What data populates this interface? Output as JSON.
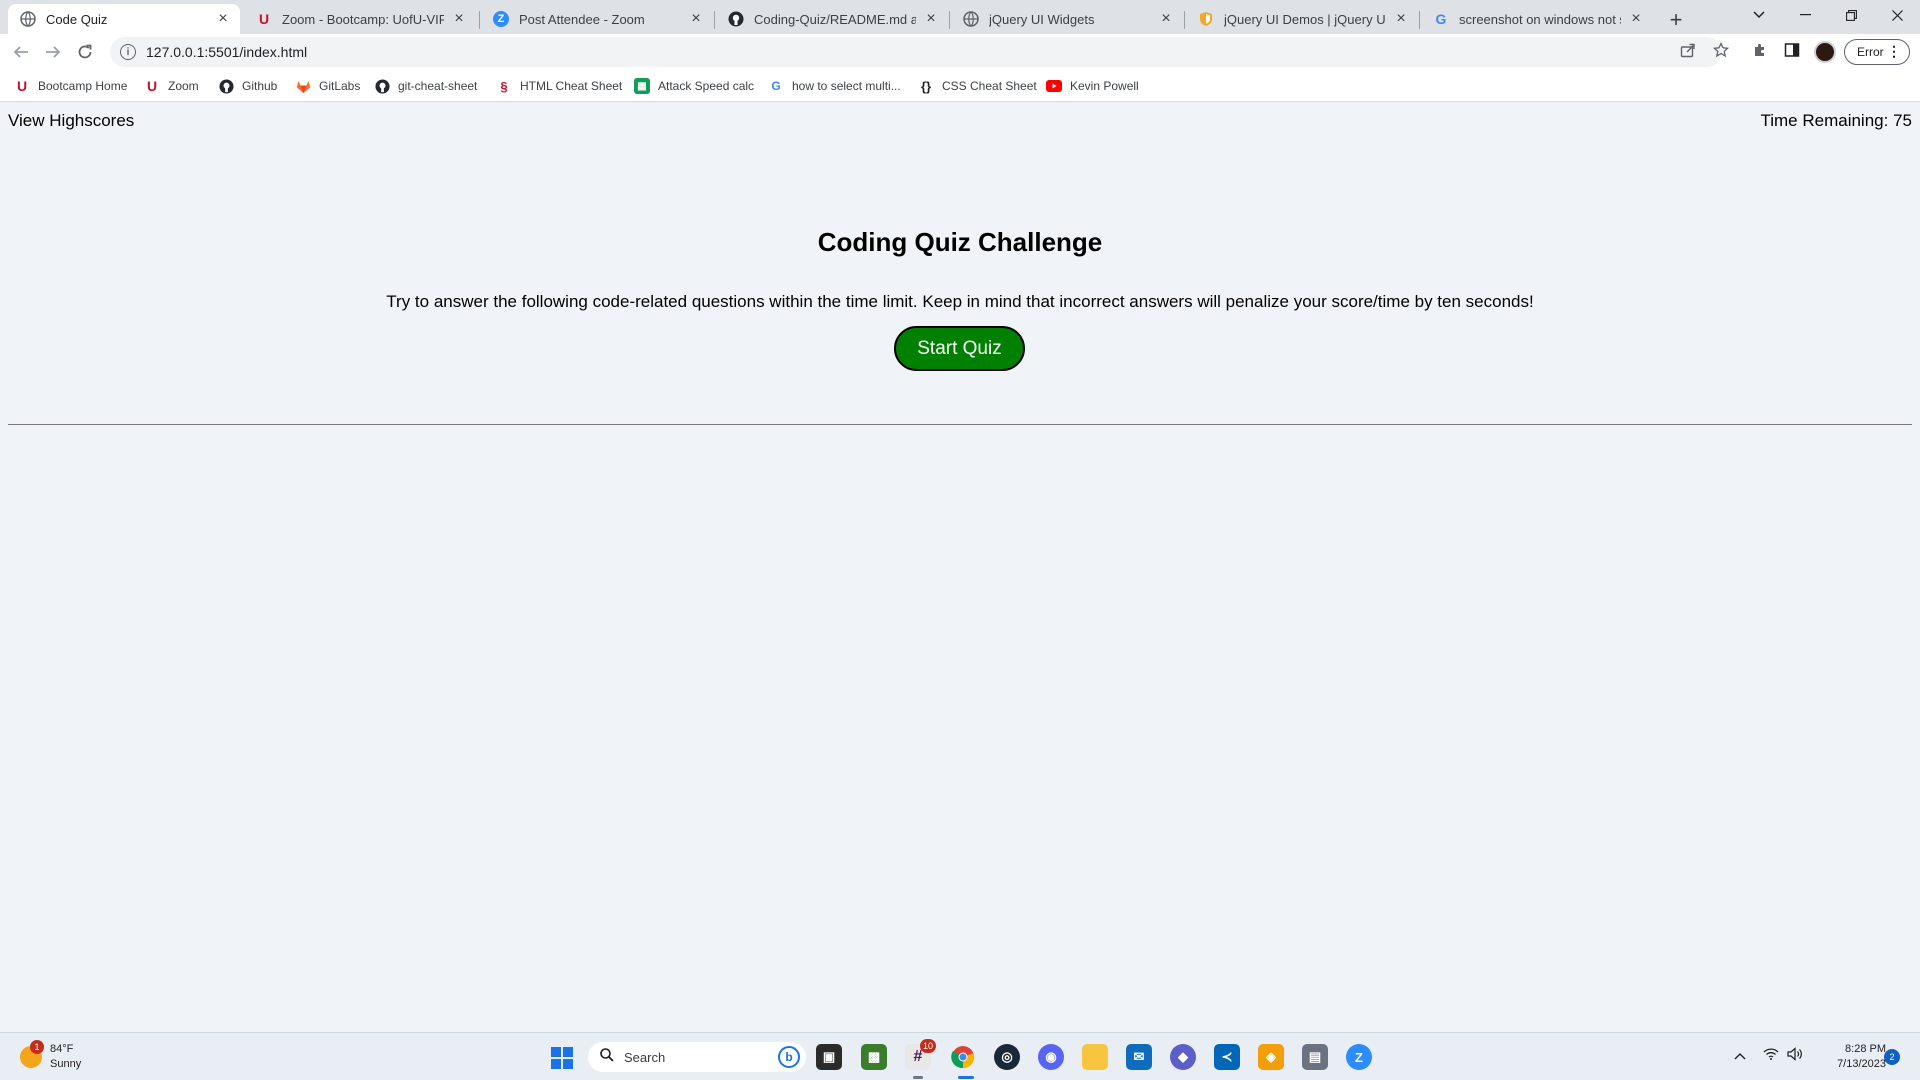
{
  "browser": {
    "tabs": [
      {
        "title": "Code Quiz",
        "active": true,
        "icon": "globe-icon"
      },
      {
        "title": "Zoom - Bootcamp: UofU-VIRT-F",
        "active": false,
        "icon": "utah-u-icon"
      },
      {
        "title": "Post Attendee - Zoom",
        "active": false,
        "icon": "zoom-icon"
      },
      {
        "title": "Coding-Quiz/README.md at ma",
        "active": false,
        "icon": "github-icon"
      },
      {
        "title": "jQuery UI Widgets",
        "active": false,
        "icon": "globe-icon"
      },
      {
        "title": "jQuery UI Demos | jQuery UI",
        "active": false,
        "icon": "jquery-shield-icon"
      },
      {
        "title": "screenshot on windows not savi",
        "active": false,
        "icon": "google-icon"
      }
    ],
    "url": "127.0.0.1:5501/index.html",
    "error_button_label": "Error",
    "bookmarks": [
      {
        "label": "Bootcamp Home",
        "icon": "utah-u-icon"
      },
      {
        "label": "Zoom",
        "icon": "utah-u-icon"
      },
      {
        "label": "Github",
        "icon": "github-icon"
      },
      {
        "label": "GitLabs",
        "icon": "gitlab-icon"
      },
      {
        "label": "git-cheat-sheet",
        "icon": "github-icon"
      },
      {
        "label": "HTML Cheat Sheet",
        "icon": "html-icon"
      },
      {
        "label": "Attack Speed calc",
        "icon": "sheets-icon"
      },
      {
        "label": "how to select multi...",
        "icon": "google-icon"
      },
      {
        "label": "CSS Cheat Sheet",
        "icon": "braces-icon"
      },
      {
        "label": "Kevin Powell",
        "icon": "youtube-icon"
      }
    ]
  },
  "page": {
    "view_highscores": "View Highscores",
    "time_label": "Time Remaining:",
    "time_value": "75",
    "title": "Coding Quiz Challenge",
    "description": "Try to answer the following code-related questions within the time limit. Keep in mind that incorrect answers will penalize your score/time by ten seconds!",
    "start_button": "Start Quiz"
  },
  "taskbar": {
    "weather_temp": "84°F",
    "weather_desc": "Sunny",
    "weather_badge": "1",
    "search_placeholder": "Search",
    "slack_badge": "10",
    "time": "8:28 PM",
    "date": "7/13/2023",
    "notification_count": "2",
    "colors": {
      "accent": "#1a73e8",
      "start_button": "#008000"
    }
  }
}
